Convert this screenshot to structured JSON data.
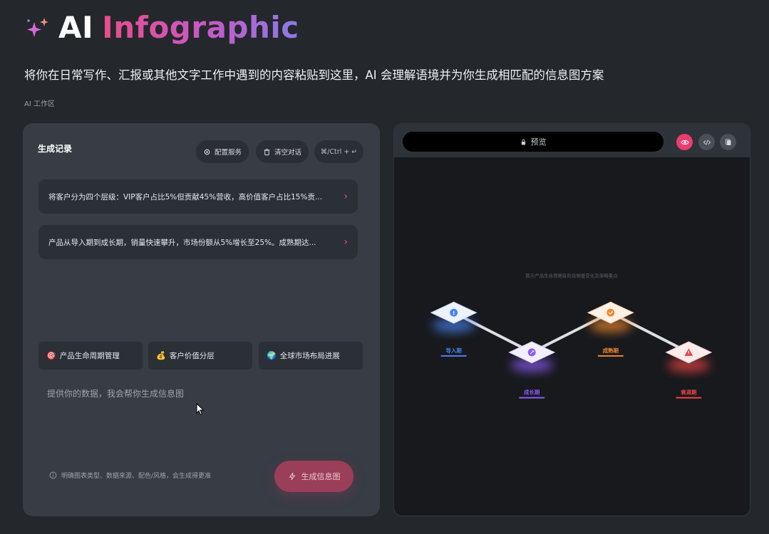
{
  "header": {
    "title_ai": "AI",
    "title_word": "Infographic",
    "subtitle": "将你在日常写作、汇报或其他文字工作中遇到的内容粘贴到这里，AI 会理解语境并为你生成相匹配的信息图方案",
    "area_label": "AI 工作区"
  },
  "left_panel": {
    "title": "生成记录",
    "buttons": {
      "config": "配置服务",
      "clear": "清空对话",
      "shortcut": "⌘/Ctrl + ↵"
    },
    "records": [
      {
        "text": "将客户分为四个层级：VIP客户占比5%但贡献45%营收，高价值客户占比15%贡..."
      },
      {
        "text": "产品从导入期到成长期，销量快速攀升，市场份额从5%增长至25%。成熟期达..."
      }
    ],
    "quick_prompts": [
      {
        "emoji": "🎯",
        "label": "产品生命周期管理"
      },
      {
        "emoji": "💰",
        "label": "客户价值分层"
      },
      {
        "emoji": "🌍",
        "label": "全球市场布局进展"
      }
    ],
    "input_placeholder": "提供你的数据，我会帮你生成信息图",
    "hint": "明确图表类型、数据来源、配色/风格，会生成得更准",
    "generate_label": "生成信息图"
  },
  "right_panel": {
    "preview_label": "预览",
    "infographic": {
      "subtitle": "展示产品生命周期各阶段销量变化及策略重点",
      "stages": [
        {
          "label": "导入期",
          "icon": "exclamation-icon",
          "color": "#4a83f0"
        },
        {
          "label": "成长期",
          "icon": "rocket-icon",
          "color": "#8b5cf6"
        },
        {
          "label": "成熟期",
          "icon": "check-icon",
          "color": "#f2882e"
        },
        {
          "label": "衰退期",
          "icon": "warning-icon",
          "color": "#ef4444"
        }
      ]
    }
  },
  "colors": {
    "accent": "#ea4c89",
    "panel": "#373c45",
    "background": "#24272c"
  }
}
